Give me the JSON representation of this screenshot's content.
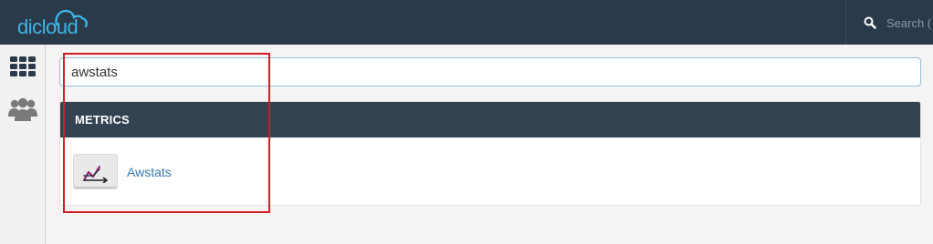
{
  "header": {
    "logo_text": "dicloud",
    "search_label": "Search ( /"
  },
  "sidebar": {
    "items": [
      {
        "name": "apps-grid",
        "icon": "grid-icon"
      },
      {
        "name": "users",
        "icon": "users-icon"
      }
    ]
  },
  "main": {
    "search_value": "awstats",
    "section_title": "METRICS",
    "results": [
      {
        "label": "Awstats",
        "icon": "awstats-chart-icon"
      }
    ]
  },
  "colors": {
    "topbar": "#293a4a",
    "panel_header": "#334352",
    "link": "#3a7ab0",
    "logo": "#3fb6e6",
    "highlight": "#d81c25",
    "icon_purple": "#8a1f7a"
  }
}
